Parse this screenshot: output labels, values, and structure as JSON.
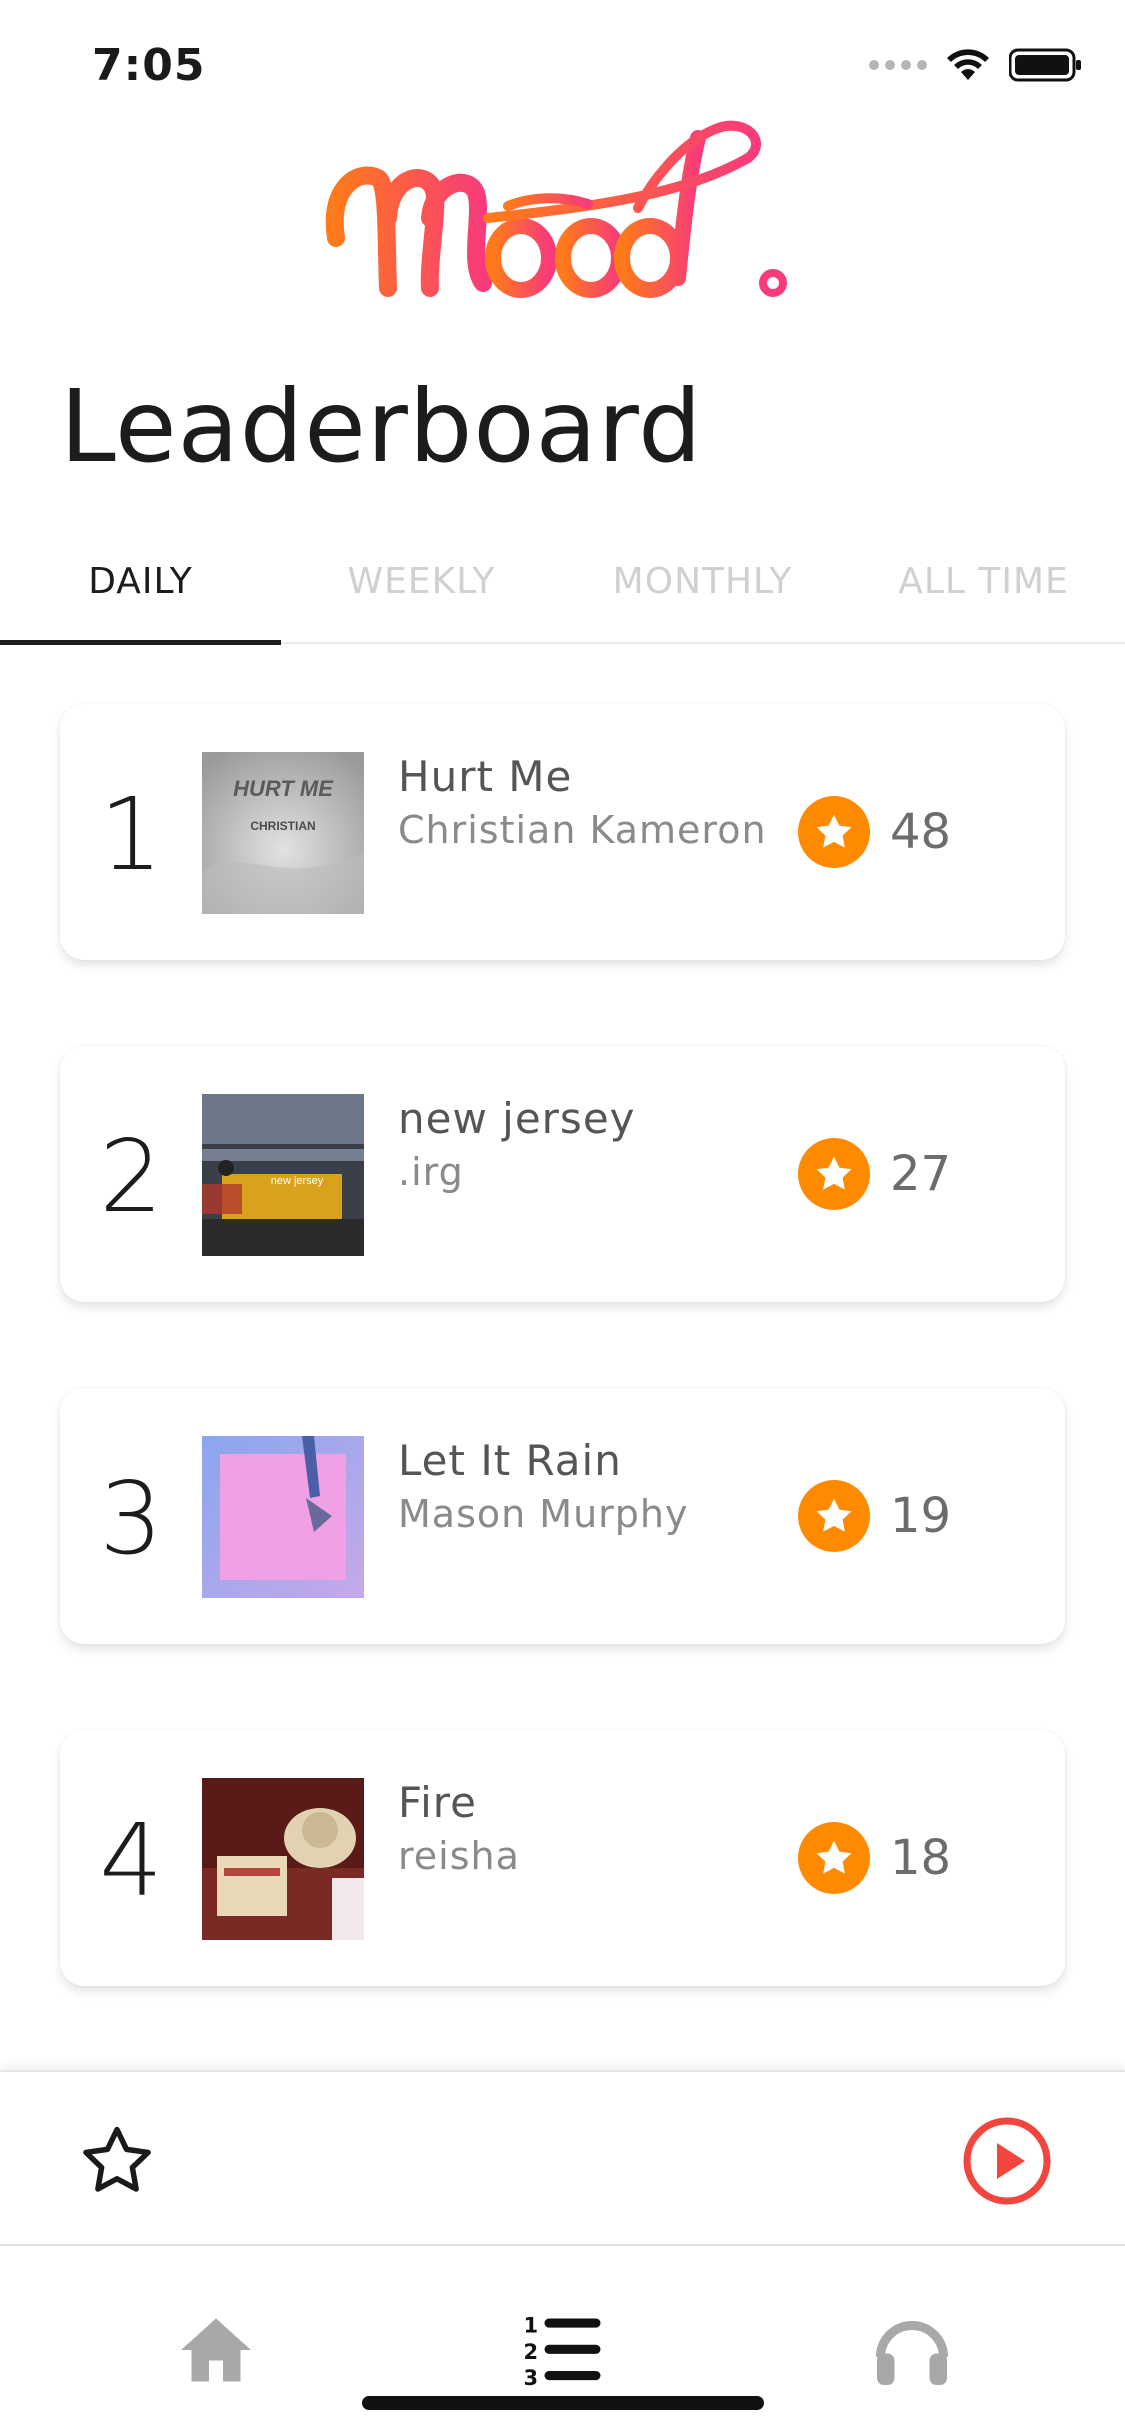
{
  "status_bar": {
    "time": "7:05"
  },
  "logo": {
    "text": "Mood."
  },
  "page_title": "Leaderboard",
  "tabs": [
    {
      "label": "DAILY",
      "active": true
    },
    {
      "label": "WEEKLY",
      "active": false
    },
    {
      "label": "MONTHLY",
      "active": false
    },
    {
      "label": "ALL TIME",
      "active": false
    }
  ],
  "entries": [
    {
      "rank": "1",
      "title": "Hurt Me",
      "artist": "Christian Kameron",
      "votes": "48",
      "cover_text": "HURT ME",
      "cover_subtext": "CHRISTIAN"
    },
    {
      "rank": "2",
      "title": "new jersey",
      "artist": ".irg",
      "votes": "27",
      "cover_text": "new jersey"
    },
    {
      "rank": "3",
      "title": "Let It Rain",
      "artist": "Mason Murphy",
      "votes": "19"
    },
    {
      "rank": "4",
      "title": "Fire",
      "artist": "reisha",
      "votes": "18"
    }
  ],
  "icons": {
    "vote": "star-icon",
    "player_favorite": "star-outline-icon",
    "player_play": "play-circle-icon",
    "tab_home": "home-icon",
    "tab_leaderboard": "ranked-list-icon",
    "tab_listen": "headphones-icon"
  },
  "colors": {
    "accent_orange": "#ff8a00",
    "play_red": "#f2453d",
    "logo_gradient_start": "#ff7a1a",
    "logo_gradient_end": "#f73b7a"
  }
}
